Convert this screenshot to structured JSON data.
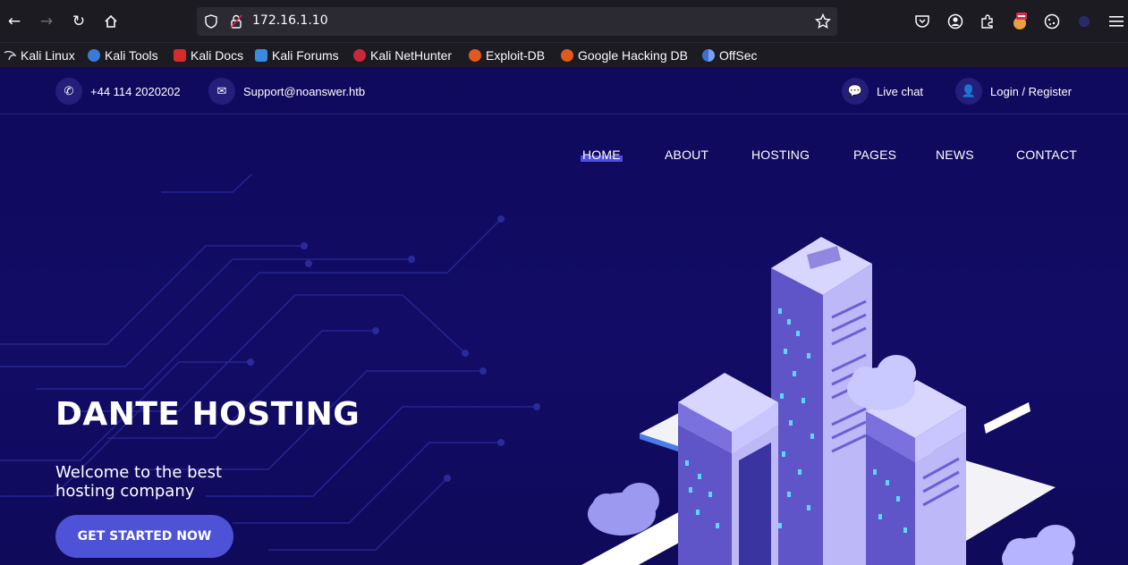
{
  "browser": {
    "url": "172.16.1.10",
    "bookmarks": [
      {
        "label": "Kali Linux",
        "icon": "kali-dragon-icon"
      },
      {
        "label": "Kali Tools",
        "icon": "kali-tools-icon"
      },
      {
        "label": "Kali Docs",
        "icon": "kali-docs-icon"
      },
      {
        "label": "Kali Forums",
        "icon": "kali-forums-icon"
      },
      {
        "label": "Kali NetHunter",
        "icon": "nethunter-icon"
      },
      {
        "label": "Exploit-DB",
        "icon": "exploit-db-icon"
      },
      {
        "label": "Google Hacking DB",
        "icon": "ghdb-icon"
      },
      {
        "label": "OffSec",
        "icon": "offsec-icon"
      }
    ]
  },
  "topbar": {
    "phone": "+44 114 2020202",
    "email": "Support@noanswer.htb",
    "live_chat": "Live chat",
    "login": "Login / Register"
  },
  "nav": {
    "items": [
      "HOME",
      "ABOUT",
      "HOSTING",
      "PAGES",
      "NEWS",
      "CONTACT"
    ],
    "active": "HOME"
  },
  "hero": {
    "title": "DANTE HOSTING",
    "subtitle_line1": "Welcome to the best",
    "subtitle_line2": "hosting company",
    "cta": "GET STARTED NOW"
  },
  "colors": {
    "background": "#0f0a5a",
    "accent": "#4d52d6",
    "browser_chrome": "#1c1b22"
  }
}
